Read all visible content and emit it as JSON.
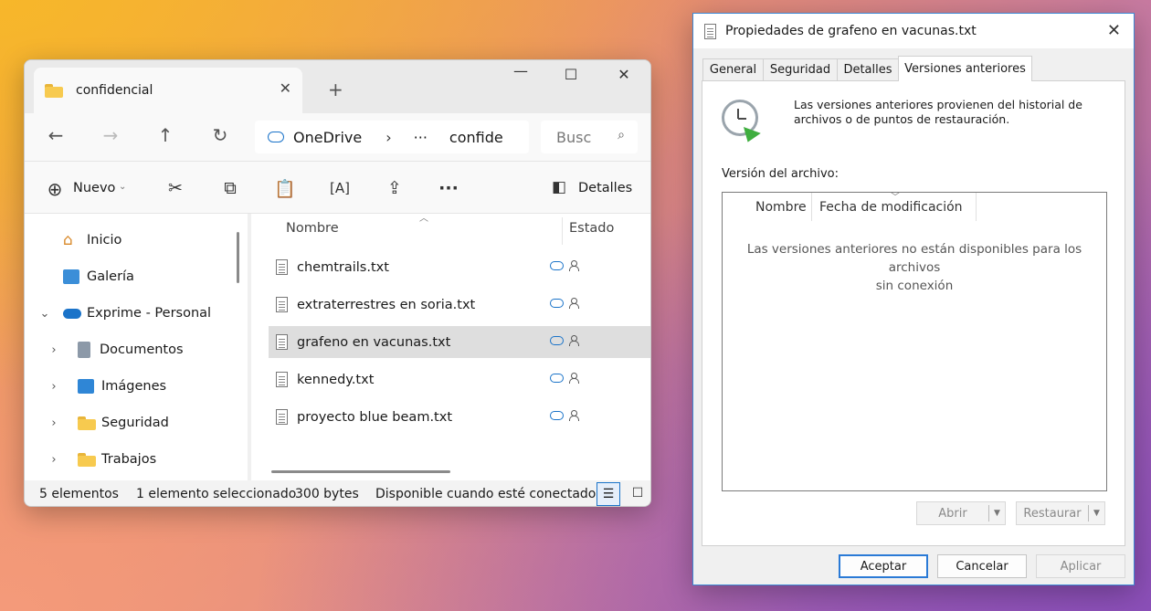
{
  "explorer": {
    "tab_title": "confidencial",
    "address": {
      "root": "OneDrive",
      "ellipsis": "···",
      "current": "confide"
    },
    "search_placeholder": "Busc",
    "toolbar": {
      "new_label": "Nuevo",
      "details_label": "Detalles"
    },
    "nav_pane": [
      {
        "label": "Inicio",
        "icon": "home-icon"
      },
      {
        "label": "Galería",
        "icon": "gallery-icon"
      },
      {
        "label": "Exprime - Personal",
        "icon": "onedrive-icon",
        "expanded": true
      },
      {
        "label": "Documentos",
        "icon": "documents-icon"
      },
      {
        "label": "Imágenes",
        "icon": "pictures-icon"
      },
      {
        "label": "Seguridad",
        "icon": "folder-icon"
      },
      {
        "label": "Trabajos",
        "icon": "folder-icon"
      }
    ],
    "columns": {
      "name": "Nombre",
      "status": "Estado"
    },
    "files": [
      {
        "name": "chemtrails.txt",
        "selected": false
      },
      {
        "name": "extraterrestres en soria.txt",
        "selected": false
      },
      {
        "name": "grafeno en vacunas.txt",
        "selected": true
      },
      {
        "name": "kennedy.txt",
        "selected": false
      },
      {
        "name": "proyecto blue beam.txt",
        "selected": false
      }
    ],
    "status_bar": {
      "count": "5 elementos",
      "selected": "1 elemento seleccionado",
      "size": "300 bytes",
      "availability": "Disponible cuando esté conectado"
    }
  },
  "properties": {
    "title": "Propiedades de grafeno en vacunas.txt",
    "tabs": [
      "General",
      "Seguridad",
      "Detalles",
      "Versiones anteriores"
    ],
    "active_tab": "Versiones anteriores",
    "info_line1": "Las versiones anteriores provienen del historial de",
    "info_line2": "archivos o de puntos de restauración.",
    "versions_label": "Versión del archivo:",
    "list_headers": {
      "name": "Nombre",
      "modified": "Fecha de modificación"
    },
    "empty_message_line1": "Las versiones anteriores no están disponibles para los archivos",
    "empty_message_line2": "sin conexión",
    "open_label": "Abrir",
    "restore_label": "Restaurar",
    "ok_label": "Aceptar",
    "cancel_label": "Cancelar",
    "apply_label": "Aplicar"
  },
  "colors": {
    "accent": "#1a73c9",
    "selection": "#dedede",
    "dialog_border": "#3c88d4"
  }
}
